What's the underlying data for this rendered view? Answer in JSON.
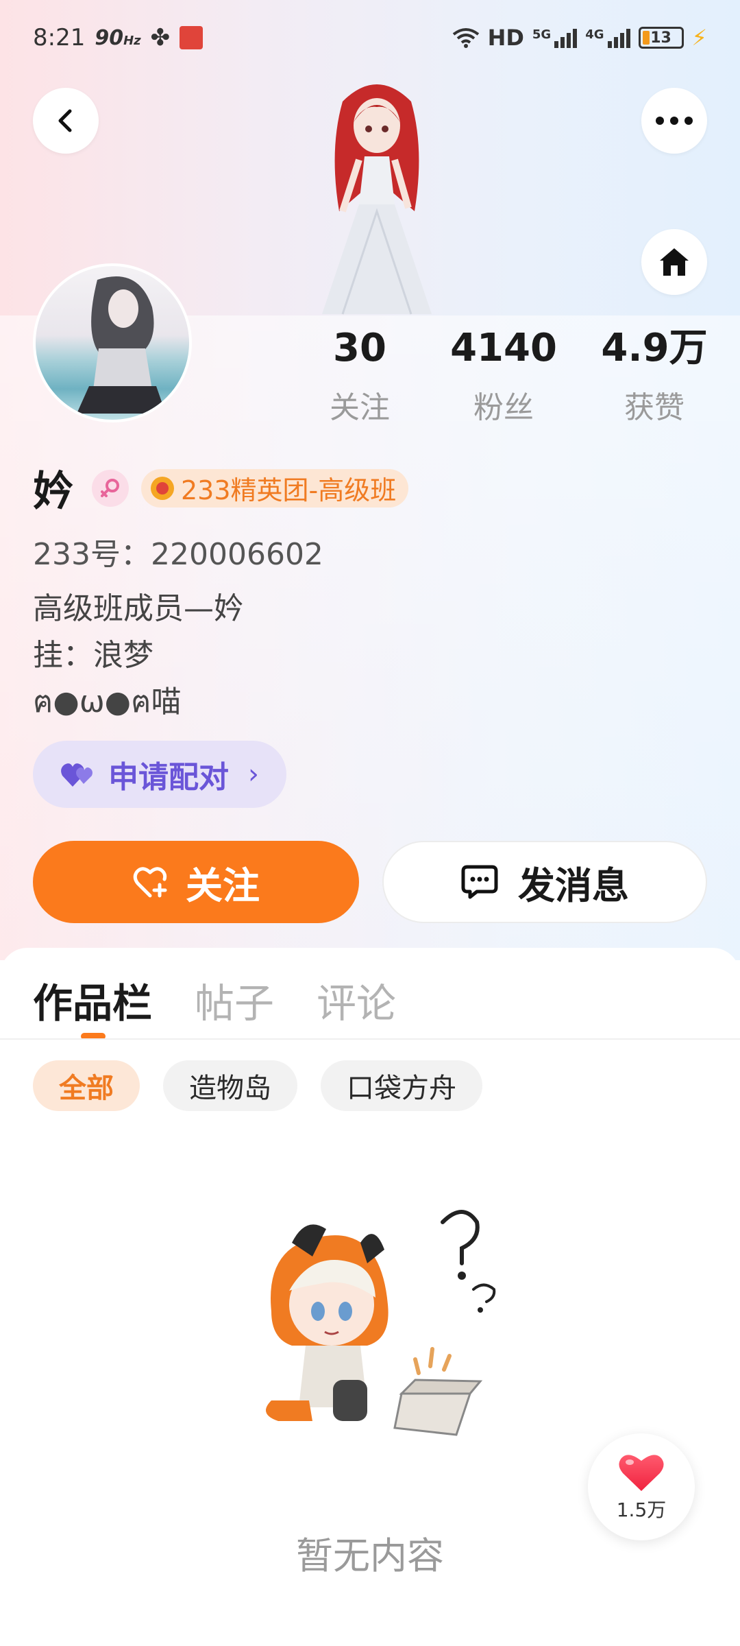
{
  "status_bar": {
    "time": "8:21",
    "refresh_rate": "90",
    "refresh_unit": "Hz",
    "network_label": "HD",
    "net1": "5G",
    "net2": "4G",
    "battery": "13"
  },
  "header": {
    "back_icon": "chevron-left-icon",
    "more_icon": "more-dots-icon",
    "home_icon": "home-icon"
  },
  "stats": [
    {
      "value": "30",
      "label": "关注"
    },
    {
      "value": "4140",
      "label": "粉丝"
    },
    {
      "value": "4.9万",
      "label": "获赞"
    }
  ],
  "profile": {
    "name": "妗",
    "gender_icon": "female-icon",
    "team_badge": "233精英团-高级班",
    "id_line": "233号：220006602",
    "bio_lines": [
      "高级班成员—妗",
      "挂：浪梦",
      "ฅ●ω●ฅ喵"
    ]
  },
  "pair_button": {
    "label": "申请配对",
    "icon": "heart-pair-icon"
  },
  "actions": {
    "follow_label": "关注",
    "message_label": "发消息"
  },
  "tabs": [
    {
      "label": "作品栏",
      "active": true
    },
    {
      "label": "帖子",
      "active": false
    },
    {
      "label": "评论",
      "active": false
    }
  ],
  "filters": [
    {
      "label": "全部",
      "active": true
    },
    {
      "label": "造物岛",
      "active": false
    },
    {
      "label": "口袋方舟",
      "active": false
    }
  ],
  "empty_state": {
    "text": "暂无内容"
  },
  "like_fab": {
    "count": "1.5万"
  },
  "colors": {
    "accent": "#fb7a1c",
    "pair_purple": "#6a55d8",
    "muted": "#9a9a9a"
  }
}
